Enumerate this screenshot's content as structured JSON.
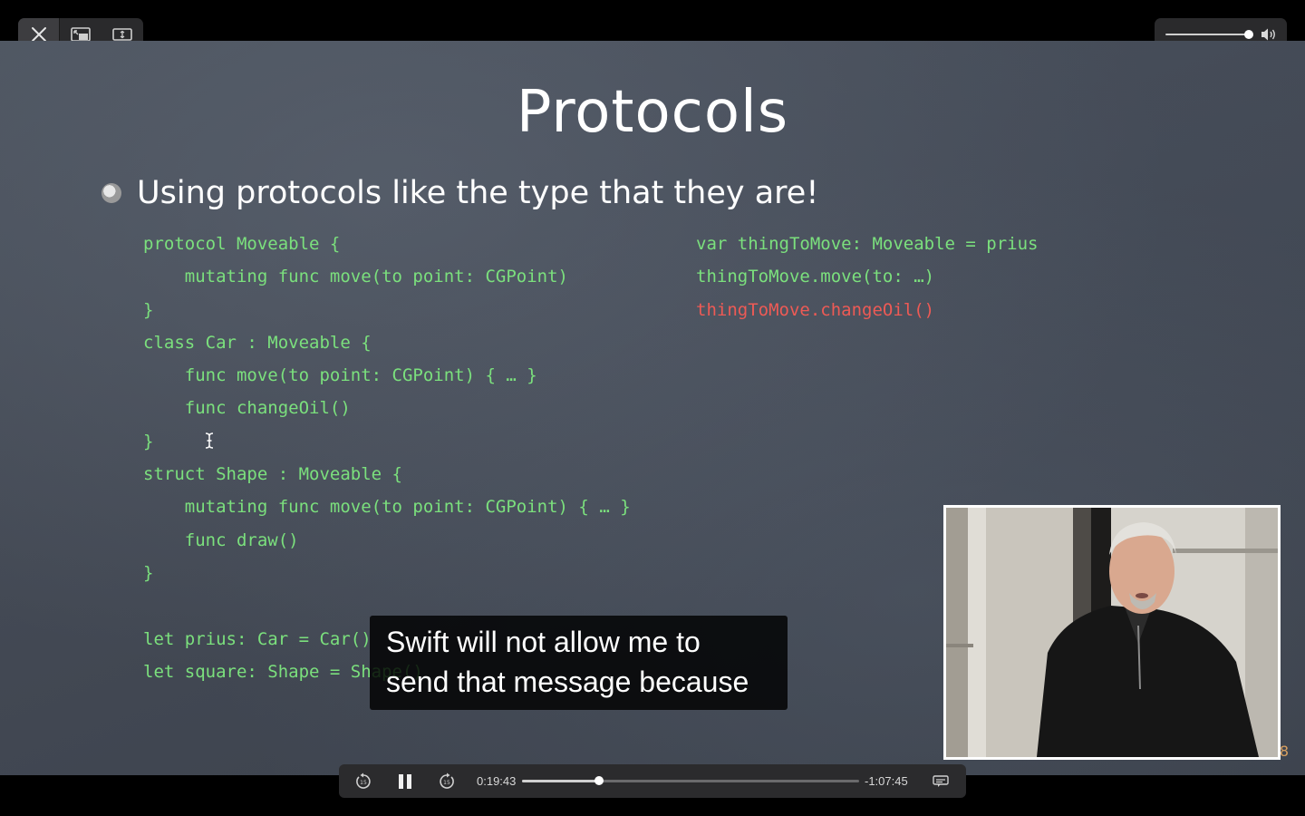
{
  "window": {
    "controls": [
      {
        "name": "close-button",
        "icon": "close-icon"
      },
      {
        "name": "picture-in-picture-button",
        "icon": "picture-in-picture-icon"
      },
      {
        "name": "fit-screen-button",
        "icon": "fit-screen-icon"
      }
    ],
    "volume": {
      "level": 0.92,
      "icon": "speaker-icon"
    }
  },
  "slide": {
    "title": "Protocols",
    "bullet": "Using protocols like the type that they are!",
    "code_left": [
      "protocol Moveable {",
      "    mutating func move(to point: CGPoint)",
      "}",
      "class Car : Moveable {",
      "    func move(to point: CGPoint) { … }",
      "    func changeOil()",
      "}",
      "struct Shape : Moveable {",
      "    mutating func move(to point: CGPoint) { … }",
      "    func draw()",
      "}"
    ],
    "code_bottom": [
      "let prius: Car = Car()",
      "let square: Shape = Shape()"
    ],
    "code_right": [
      "var thingToMove: Moveable = prius",
      "thingToMove.move(to: …)",
      "thingToMove.changeOil()"
    ],
    "code_right_error_index": 2,
    "page_number": "8",
    "colors": {
      "code": "#7be07d",
      "error": "#ee5a55"
    }
  },
  "subtitles": {
    "line1": "Swift will not allow me to",
    "line2": "send that message because"
  },
  "playback": {
    "elapsed": "0:19:43",
    "remaining": "-1:07:45",
    "progress": 0.229,
    "buttons": {
      "skip_back": "skip-back-15-icon",
      "pause": "pause-icon",
      "skip_forward": "skip-forward-15-icon",
      "captions": "captions-icon"
    }
  }
}
